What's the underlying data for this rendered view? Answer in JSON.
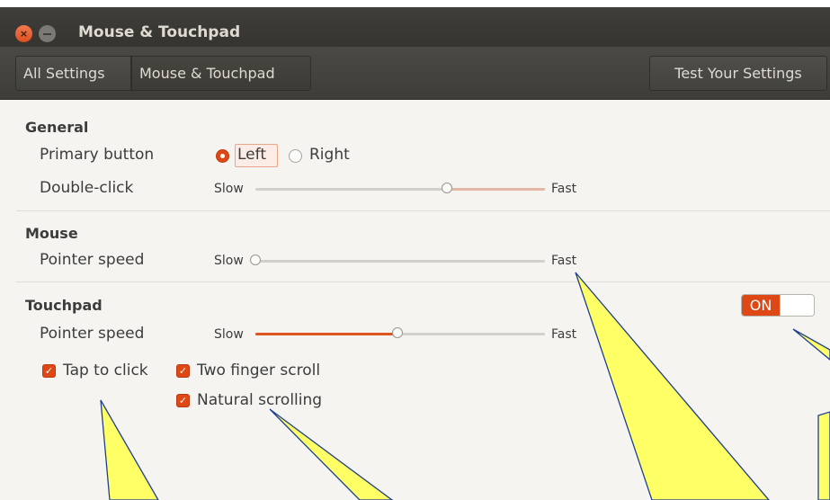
{
  "window": {
    "title": "Mouse & Touchpad"
  },
  "toolbar": {
    "all_settings": "All Settings",
    "current": "Mouse & Touchpad",
    "test": "Test Your Settings"
  },
  "general": {
    "title": "General",
    "primary_button_label": "Primary button",
    "primary_options": [
      "Left",
      "Right"
    ],
    "primary_selected": "Left",
    "double_click_label": "Double-click",
    "double_click_value": 0.66
  },
  "mouse": {
    "title": "Mouse",
    "pointer_speed_label": "Pointer speed",
    "pointer_speed_value": 0.0
  },
  "touchpad": {
    "title": "Touchpad",
    "switch_label": "ON",
    "switch_on": true,
    "pointer_speed_label": "Pointer speed",
    "pointer_speed_value": 0.49,
    "tap_to_click": "Tap to click",
    "two_finger_scroll": "Two finger scroll",
    "natural_scrolling": "Natural scrolling"
  },
  "slider": {
    "slow": "Slow",
    "fast": "Fast"
  },
  "colors": {
    "accent": "#dd4814",
    "titlebar": "#3f3e3b",
    "callout_fill": "#ffff66",
    "callout_stroke": "#1f3f8f"
  }
}
